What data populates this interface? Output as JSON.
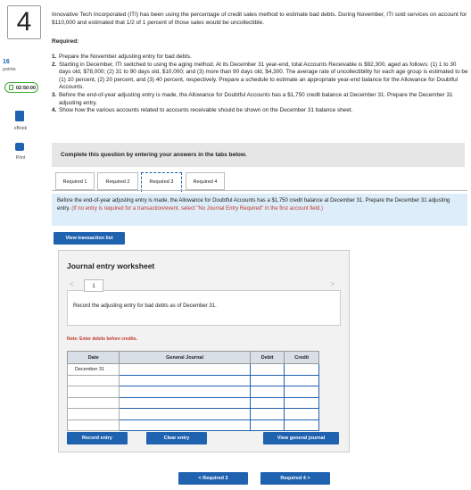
{
  "question": {
    "number": "4",
    "points_value": "16",
    "points_label": "points",
    "timer": "02:50:00"
  },
  "sidebar": {
    "ebook_label": "eBook",
    "print_label": "Print"
  },
  "intro": "Innovative Tech Incorporated (ITI) has been using the percentage of credit sales method to estimate bad debts. During November, ITI sold services on account for $110,000 and estimated that 1/2 of 1 percent of those sales would be uncollectible.",
  "required_heading": "Required:",
  "requirements": [
    {
      "n": "1.",
      "text": "Prepare the November adjusting entry for bad debts."
    },
    {
      "n": "2.",
      "text": "Starting in December, ITI switched to using the aging method. At its December 31 year-end, total Accounts Receivable is $92,300, aged as follows: (1) 1 to 30 days old, $78,000; (2) 31 to 90 days old, $10,000; and (3) more than 90 days old, $4,300. The average rate of uncollectibility for each age group is estimated to be (1) 10 percent, (2) 20 percent, and (3) 40 percent, respectively. Prepare a schedule to estimate an appropriate year-end balance for the Allowance for Doubtful Accounts."
    },
    {
      "n": "3.",
      "text": "Before the end-of-year adjusting entry is made, the Allowance for Doubtful Accounts has a $1,750 credit balance at December 31. Prepare the December 31 adjusting entry."
    },
    {
      "n": "4.",
      "text": "Show how the various accounts related to accounts receivable should be shown on the December 31 balance sheet."
    }
  ],
  "banner": "Complete this question by entering your answers in the tabs below.",
  "tabs": [
    "Required 1",
    "Required 2",
    "Required 3",
    "Required 4"
  ],
  "info": {
    "text": "Before the end-of-year adjusting entry is made, the Allowance for Doubtful Accounts has a $1,750 credit balance at December 31. Prepare the December 31 adjusting entry. ",
    "note": "(If no entry is required for a transaction/event, select \"No Journal Entry Required\" in the first account field.)"
  },
  "view_transaction_label": "View transaction list",
  "worksheet": {
    "title": "Journal entry worksheet",
    "prev": "<",
    "next": ">",
    "page": "1",
    "description": "Record the adjusting entry for bad debts as of December 31.",
    "note": "Note: Enter debits before credits.",
    "columns": {
      "date": "Date",
      "journal": "General Journal",
      "debit": "Debit",
      "credit": "Credit"
    },
    "first_date": "December 31",
    "record_label": "Record entry",
    "clear_label": "Clear entry",
    "view_journal_label": "View general journal"
  },
  "nav": {
    "prev_label": "< Required 2",
    "next_label": "Required 4 >"
  },
  "colors": {
    "accent": "#1f62b0",
    "timer": "#3aa635",
    "note": "#c0392b",
    "info_bg": "#ddeefa"
  }
}
